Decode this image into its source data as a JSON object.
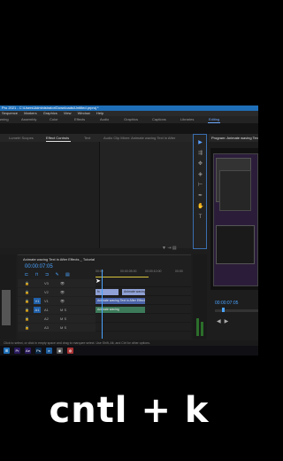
{
  "window": {
    "title": "Pro 2021 - C:\\Users\\Administrator\\Downloads\\Untitled.prproj *"
  },
  "menu": [
    "Sequence",
    "Markers",
    "Graphics",
    "View",
    "Window",
    "Help"
  ],
  "workspaces": {
    "items": [
      "Learning",
      "Assembly",
      "Color",
      "Effects",
      "Audio",
      "Graphics",
      "Captions",
      "Libraries",
      "Editing"
    ],
    "active": "Editing"
  },
  "source_tabs": [
    "Lumetri Scopes",
    "Effect Controls",
    "Text",
    "Audio Clip Mixer: Animate waving Text in After"
  ],
  "active_source_tab": "Effect Controls",
  "program": {
    "title": "Program: Animate waving Text in Afte",
    "timecode": "00:00:07:05"
  },
  "timeline": {
    "title": "Animate waving Text in After Effects _ Tutorial",
    "timecode": "00:00:07:05",
    "ruler": [
      "00:00",
      "00:00:05:00",
      "00:00:10:00",
      "00:00"
    ],
    "tracks": [
      {
        "lock": "🔒",
        "src": "",
        "name": "V3",
        "eye": "👁"
      },
      {
        "lock": "🔒",
        "src": "",
        "name": "V2",
        "eye": "👁"
      },
      {
        "lock": "🔒",
        "src": "V1",
        "name": "V1",
        "eye": "👁"
      },
      {
        "lock": "🔒",
        "src": "A1",
        "name": "A1",
        "eye": "M S"
      },
      {
        "lock": "🔒",
        "src": "",
        "name": "A2",
        "eye": "M S"
      },
      {
        "lock": "🔒",
        "src": "",
        "name": "A3",
        "eye": "M S"
      }
    ],
    "clips": {
      "fx": "fx",
      "video": "Animate waving",
      "audio_1": "Animate waving Text in After Effects",
      "audio_2": "Animate waving"
    }
  },
  "status": "Click to select, or click in empty space and drag to marquee select. Use Shift, Alt, and Ctrl for other options.",
  "taskbar": [
    "⊞",
    "Pr",
    "Ae",
    "Ps",
    "e",
    "◉",
    "◍"
  ],
  "caption": "cntl + k",
  "colors": {
    "accent": "#4aa3ff",
    "titlebar": "#1f6fb8",
    "workbar": "#d7c33a"
  }
}
